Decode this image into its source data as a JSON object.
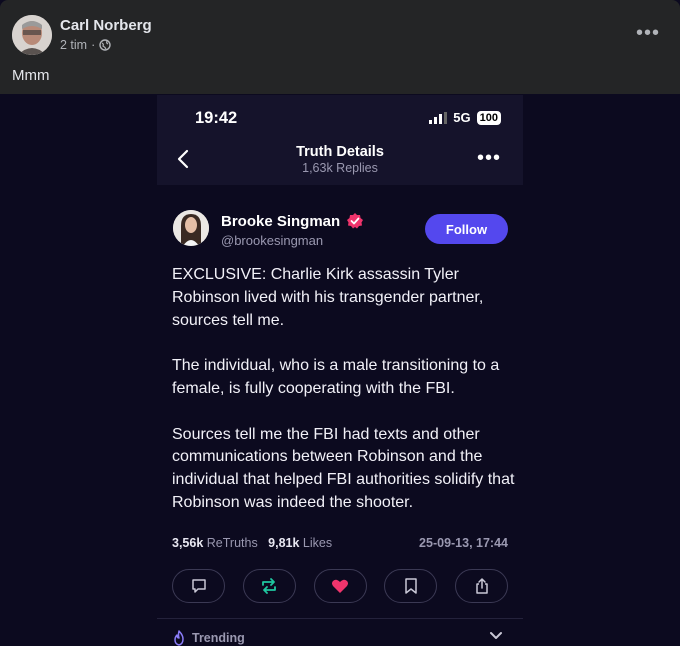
{
  "facebook": {
    "author": "Carl Norberg",
    "time": "2 tim",
    "separator": "·",
    "caption": "Mmm"
  },
  "phone": {
    "time": "19:42",
    "network": "5G",
    "battery": "100",
    "nav_title": "Truth Details",
    "nav_sub": "1,63k Replies"
  },
  "post": {
    "name": "Brooke Singman",
    "handle": "@brookesingman",
    "follow_label": "Follow",
    "paragraphs": [
      "EXCLUSIVE: Charlie Kirk assassin Tyler Robinson lived with his transgender partner, sources tell me.",
      "The individual, who is a male transitioning to a female, is fully cooperating with the FBI.",
      "Sources tell me the FBI had texts and other communications between Robinson and the individual that helped FBI authorities solidify that Robinson was indeed the shooter."
    ],
    "retruths_count": "3,56k",
    "retruths_label": "ReTruths",
    "likes_count": "9,81k",
    "likes_label": "Likes",
    "date": "25-09-13, 17:44"
  },
  "trending_label": "Trending",
  "icons": {
    "globe": "globe-icon",
    "back": "chevron-left-icon",
    "verified": "verified-badge-icon",
    "reply": "comment-icon",
    "retruth": "retruth-icon",
    "like": "heart-icon",
    "bookmark": "bookmark-icon",
    "share": "share-icon",
    "trending": "flame-icon"
  },
  "colors": {
    "follow": "#5448ee",
    "heart": "#f0346c",
    "retruth": "#1fc8a0",
    "verified": "#f0346c"
  }
}
